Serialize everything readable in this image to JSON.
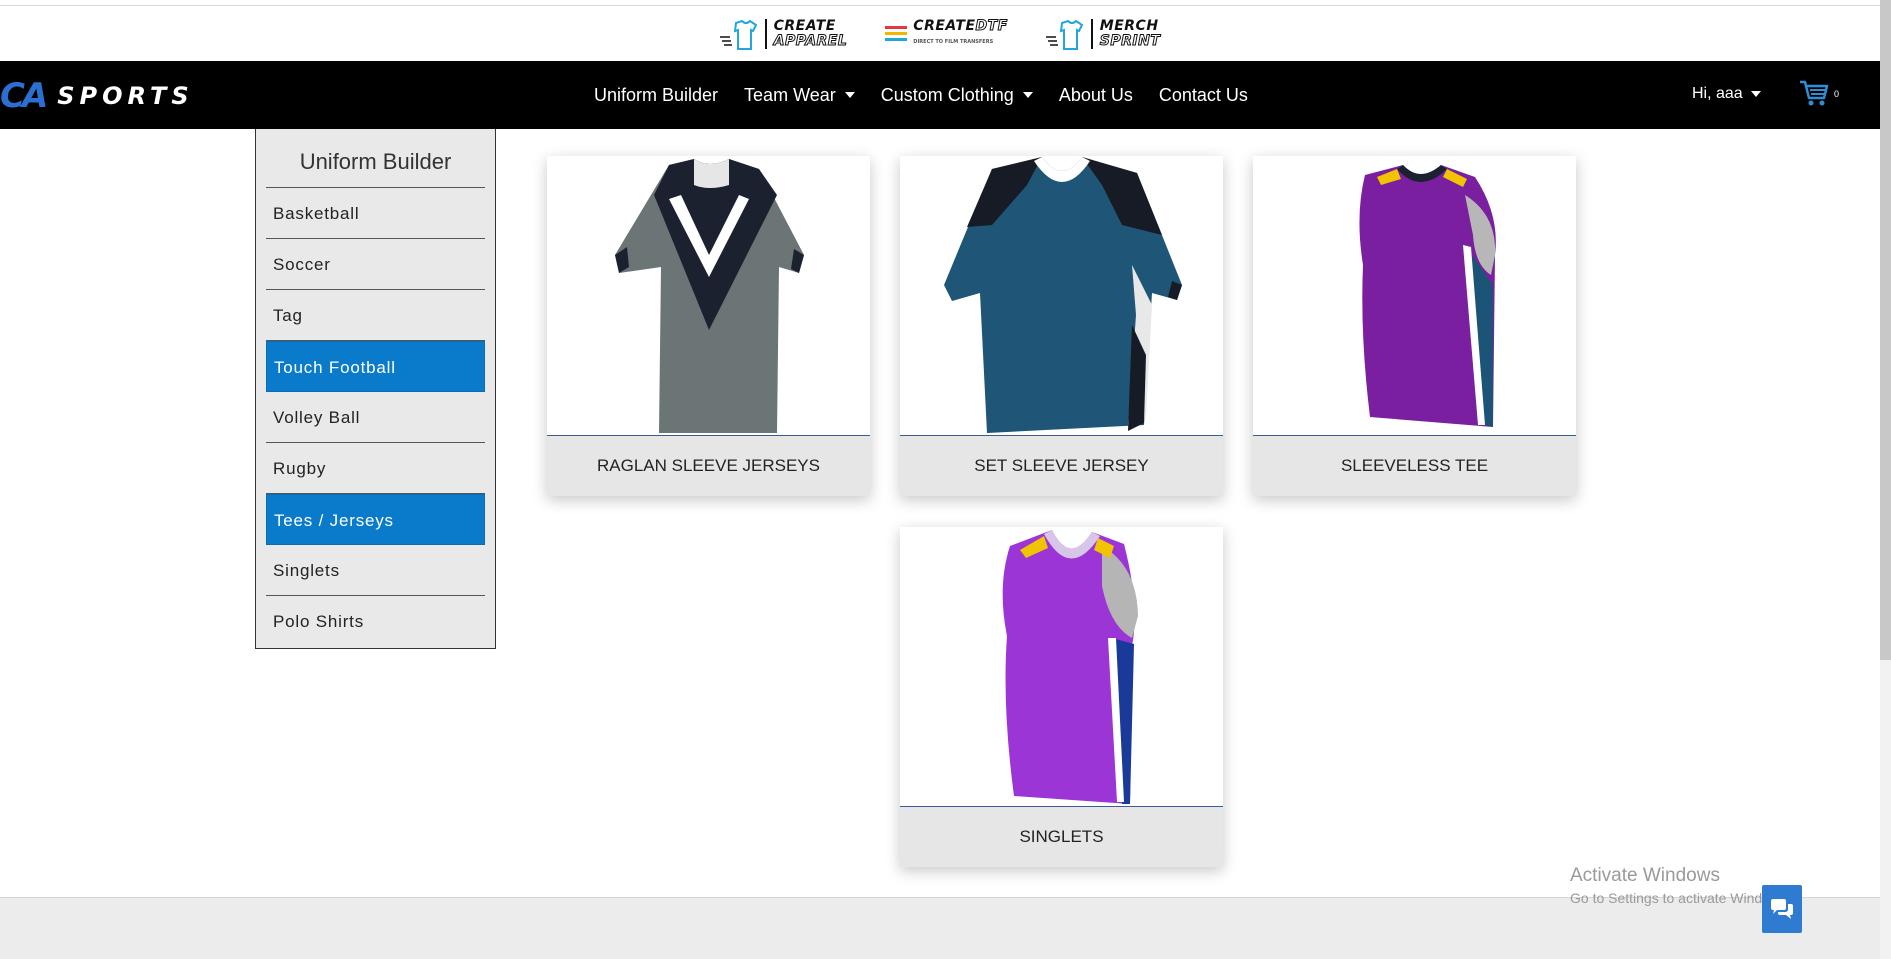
{
  "brands": [
    {
      "line1": "CREATE",
      "line2": "APPAREL",
      "icon": "tshirt-icon"
    },
    {
      "line1": "CREATE",
      "line2": "DTF",
      "tagline": "DIRECT TO FILM TRANSFERS",
      "icon": "dtf-stripes-icon"
    },
    {
      "line1": "MERCH",
      "line2": "SPRINT",
      "icon": "tshirt-icon"
    }
  ],
  "logo": {
    "mark": "CA",
    "text": "SPORTS",
    "color": "#2a6fd1"
  },
  "nav": {
    "items": [
      {
        "label": "Uniform Builder",
        "dropdown": false
      },
      {
        "label": "Team Wear",
        "dropdown": true
      },
      {
        "label": "Custom Clothing",
        "dropdown": true
      },
      {
        "label": "About Us",
        "dropdown": false
      },
      {
        "label": "Contact Us",
        "dropdown": false
      }
    ],
    "user_greeting": "Hi, aaa",
    "cart_count": "0"
  },
  "sidebar": {
    "title": "Uniform Builder",
    "items": [
      {
        "label": "Basketball",
        "active": false
      },
      {
        "label": "Soccer",
        "active": false
      },
      {
        "label": "Tag",
        "active": false
      },
      {
        "label": "Touch Football",
        "active": true
      },
      {
        "label": "Volley Ball",
        "active": false
      },
      {
        "label": "Rugby",
        "active": false
      },
      {
        "label": "Tees / Jerseys",
        "active": true
      },
      {
        "label": "Singlets",
        "active": false
      },
      {
        "label": "Polo Shirts",
        "active": false
      }
    ],
    "active_color": "#0a7bcb"
  },
  "products": [
    {
      "name": "RAGLAN SLEEVE JERSEYS",
      "colors": [
        "#6b7575",
        "#1c2130",
        "#ffffff"
      ]
    },
    {
      "name": "SET SLEEVE JERSEY",
      "colors": [
        "#1f5577",
        "#161b26",
        "#ffffff"
      ]
    },
    {
      "name": "SLEEVELESS TEE",
      "colors": [
        "#7a1fa0",
        "#1c5478",
        "#f2c300"
      ]
    },
    {
      "name": "SINGLETS",
      "colors": [
        "#9b35d6",
        "#1a3a9a",
        "#f2c300"
      ]
    }
  ],
  "os_watermark": {
    "title": "Activate Windows",
    "subtitle": "Go to Settings to activate Windows."
  },
  "chat_icon": "chat-bubbles-icon"
}
